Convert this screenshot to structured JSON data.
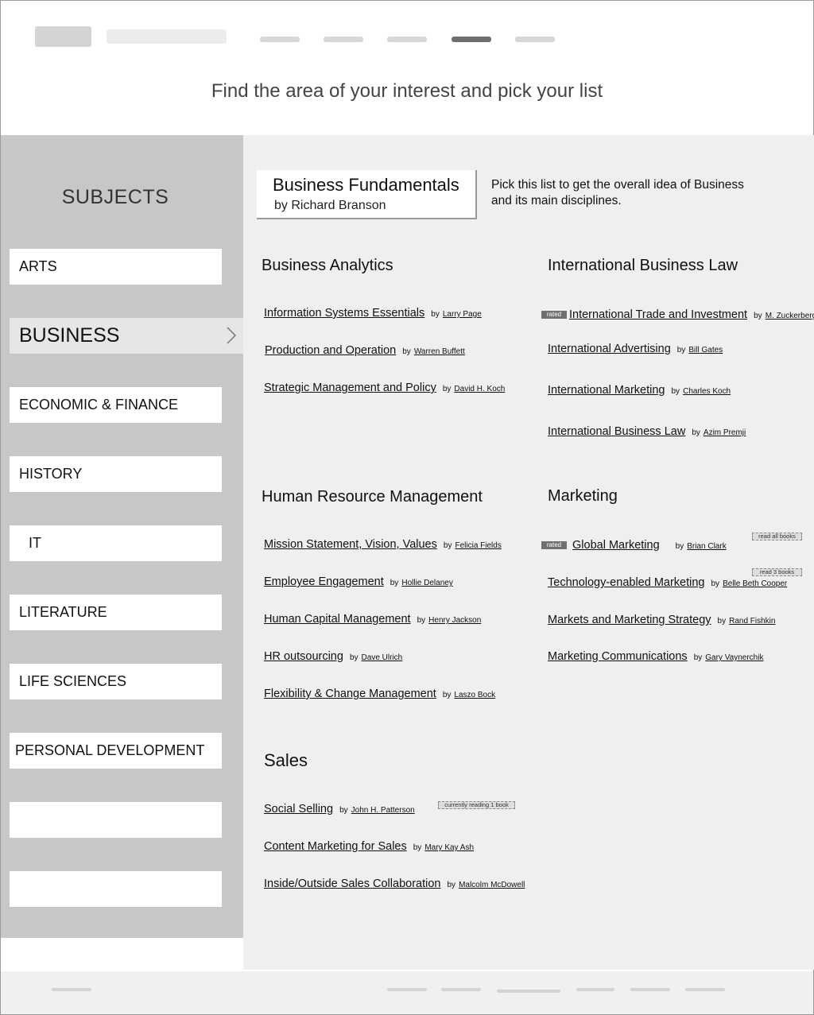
{
  "header": {
    "headline": "Find the area of your interest and pick your list"
  },
  "sidebar": {
    "title": "SUBJECTS",
    "items": [
      {
        "label": "ARTS"
      },
      {
        "label": "BUSINESS"
      },
      {
        "label": "ECONOMIC & FINANCE"
      },
      {
        "label": "HISTORY"
      },
      {
        "label": "IT"
      },
      {
        "label": "LITERATURE"
      },
      {
        "label": "LIFE SCIENCES"
      },
      {
        "label": "PERSONAL DEVELOPMENT"
      },
      {
        "label": ""
      },
      {
        "label": ""
      }
    ],
    "active_index": 1
  },
  "featured": {
    "title": "Business Fundamentals",
    "author": "by Richard Branson",
    "description": "Pick this list to get the overall idea of Business and its main disciplines."
  },
  "categories": {
    "analytics": {
      "title": "Business Analytics",
      "books": [
        {
          "title": "Information Systems Essentials",
          "by": "by",
          "author": "Larry Page"
        },
        {
          "title": "Production and Operation",
          "by": "by",
          "author": "Warren Buffett"
        },
        {
          "title": "Strategic Management and Policy",
          "by": "by",
          "author": "David H. Koch"
        }
      ]
    },
    "intl_law": {
      "title": "International Business Law",
      "books": [
        {
          "title": "International Trade and Investment",
          "by": "by",
          "author": "M. Zuckerberg",
          "badge": "rated"
        },
        {
          "title": "International Advertising",
          "by": "by",
          "author": "Bill Gates"
        },
        {
          "title": "International Marketing",
          "by": "by",
          "author": "Charles Koch"
        },
        {
          "title": "International Business Law",
          "by": "by",
          "author": "Azim Premji"
        }
      ]
    },
    "hr": {
      "title": "Human Resource Management",
      "books": [
        {
          "title": "Mission Statement, Vision, Values",
          "by": "by",
          "author": "Felicia Fields"
        },
        {
          "title": "Employee Engagement",
          "by": "by",
          "author": "Hollie Delaney"
        },
        {
          "title": "Human Capital Management",
          "by": "by",
          "author": "Henry Jackson"
        },
        {
          "title": "HR outsourcing",
          "by": "by",
          "author": "Dave Ulrich"
        },
        {
          "title": "Flexibility & Change Management",
          "by": "by",
          "author": "Laszo Bock"
        }
      ]
    },
    "marketing": {
      "title": "Marketing",
      "books": [
        {
          "title": "Global Marketing",
          "by": "by",
          "author": "Brian Clark",
          "badge": "rated"
        },
        {
          "title": "Technology-enabled Marketing",
          "by": "by",
          "author": "Belle Beth Cooper"
        },
        {
          "title": "Markets and Marketing Strategy",
          "by": "by",
          "author": "Rand Fishkin"
        },
        {
          "title": "Marketing Communications",
          "by": "by",
          "author": "Gary Vaynerchik"
        }
      ],
      "tags": [
        "read all books",
        "read 3 books"
      ]
    },
    "sales": {
      "title": "Sales",
      "books": [
        {
          "title": "Social Selling",
          "by": "by",
          "author": "John H. Patterson"
        },
        {
          "title": "Content Marketing for Sales",
          "by": "by",
          "author": "Mary Kay Ash"
        },
        {
          "title": "Inside/Outside Sales Collaboration",
          "by": "by",
          "author": "Malcolm McDowell"
        }
      ],
      "tags": [
        "currently reading 1 book"
      ]
    }
  }
}
